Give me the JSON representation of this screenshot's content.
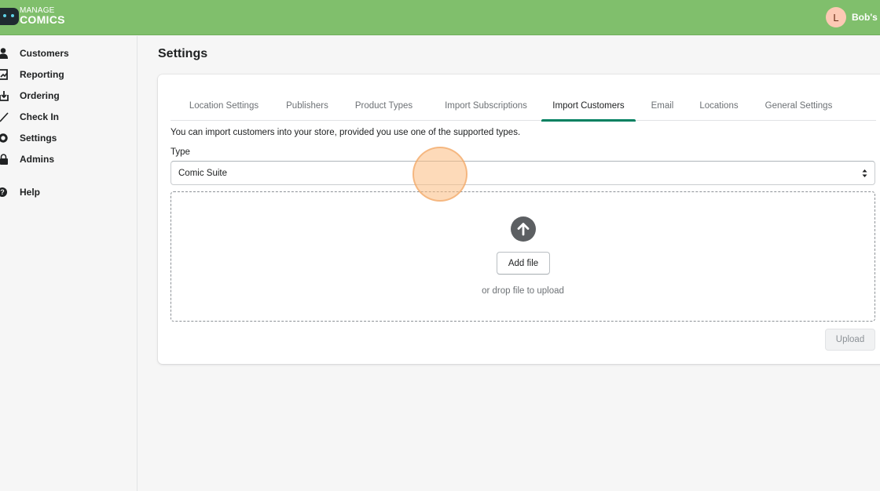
{
  "app": {
    "logo_top": "MANAGE",
    "logo_bottom": "COMICS",
    "user_initial": "L",
    "user_name": "Bob's I",
    "accent_color": "#80bf6c"
  },
  "sidebar": {
    "items": [
      {
        "label": "Customers",
        "icon": "person-icon"
      },
      {
        "label": "Reporting",
        "icon": "report-icon"
      },
      {
        "label": "Ordering",
        "icon": "download-icon"
      },
      {
        "label": "Check In",
        "icon": "checkmark-icon"
      },
      {
        "label": "Settings",
        "icon": "gear-icon"
      },
      {
        "label": "Admins",
        "icon": "lock-icon"
      },
      {
        "label": "Help",
        "icon": "question-icon"
      }
    ]
  },
  "page": {
    "title": "Settings"
  },
  "tabs": [
    {
      "label": "Location Settings"
    },
    {
      "label": "Publishers"
    },
    {
      "label": "Product Types"
    },
    {
      "label": "Import Subscriptions"
    },
    {
      "label": "Import Customers",
      "active": true
    },
    {
      "label": "Email"
    },
    {
      "label": "Locations"
    },
    {
      "label": "General Settings"
    }
  ],
  "import": {
    "intro": "You can import customers into your store, provided you use one of the supported types.",
    "type_label": "Type",
    "type_value": "Comic Suite",
    "add_file_label": "Add file",
    "drop_hint": "or drop file to upload",
    "upload_label": "Upload"
  }
}
